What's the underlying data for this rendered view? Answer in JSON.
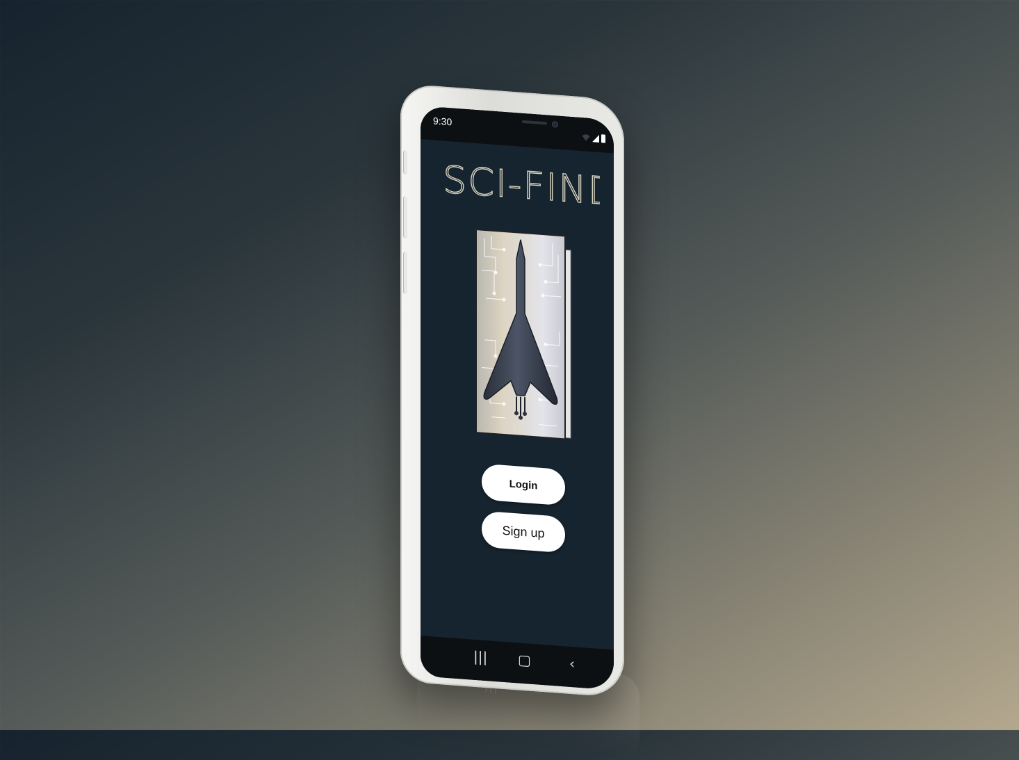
{
  "status_bar": {
    "time": "9:30"
  },
  "app": {
    "title": "SCI-FINDS"
  },
  "buttons": {
    "login_label": "Login",
    "signup_label": "Sign up"
  },
  "nav_bar": {
    "recents_glyph": "|||",
    "home_glyph": "▢",
    "back_glyph": "‹"
  },
  "colors": {
    "screen_background": "#16242f",
    "button_fill": "#ffffff",
    "logo_stroke": "#d8d3bf",
    "device_frame": "#efefec"
  },
  "icons": [
    "wifi-icon",
    "signal-icon",
    "battery-icon",
    "recents-icon",
    "home-icon",
    "back-icon"
  ]
}
